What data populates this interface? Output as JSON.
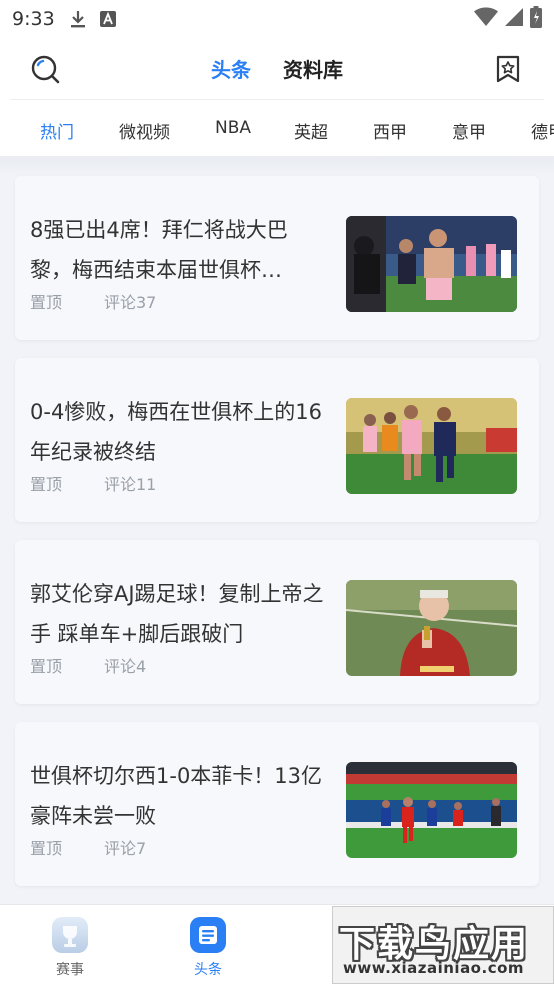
{
  "status_bar": {
    "time": "9:33"
  },
  "header": {
    "tabs": [
      {
        "label": "头条",
        "active": true
      },
      {
        "label": "资料库",
        "active": false
      }
    ]
  },
  "categories": [
    {
      "label": "热门",
      "active": true
    },
    {
      "label": "微视频"
    },
    {
      "label": "NBA"
    },
    {
      "label": "英超"
    },
    {
      "label": "西甲"
    },
    {
      "label": "意甲"
    },
    {
      "label": "德甲"
    }
  ],
  "articles": [
    {
      "title": "8强已出4席！拜仁将战大巴黎，梅西结束本届世俱杯…",
      "pin": "置顶",
      "comments": "评论37"
    },
    {
      "title": "0-4惨败，梅西在世俱杯上的16年纪录被终结",
      "pin": "置顶",
      "comments": "评论11"
    },
    {
      "title": "郭艾伦穿AJ踢足球！复制上帝之手 踩单车+脚后跟破门",
      "pin": "置顶",
      "comments": "评论4"
    },
    {
      "title": "世俱杯切尔西1-0本菲卡！13亿豪阵未尝一败",
      "pin": "置顶",
      "comments": "评论7"
    }
  ],
  "bottom_nav": [
    {
      "label": "赛事",
      "active": false
    },
    {
      "label": "头条",
      "active": true
    }
  ],
  "watermark": {
    "title": "下载鸟应用",
    "url": "www.xiazainiao.com"
  },
  "colors": {
    "accent": "#2b7ff5",
    "background": "#f1f3f8",
    "card": "#f7f8fc",
    "meta_text": "#9aa0a8"
  }
}
